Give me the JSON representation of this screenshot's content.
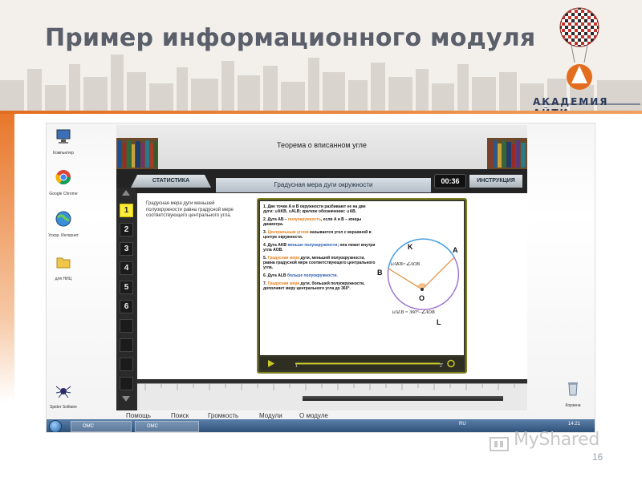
{
  "slide": {
    "title": "Пример информационного модуля",
    "page_number": "16",
    "logo_text": "АКАДЕМИЯ АЙТИ",
    "watermark": "MyShared"
  },
  "desktop": {
    "icons": [
      {
        "name": "computer",
        "label": "Компьютер"
      },
      {
        "name": "chrome",
        "label": "Google Chrome"
      },
      {
        "name": "globe",
        "label": "Ускор. Интернет"
      },
      {
        "name": "folder",
        "label": "для НИЦ"
      },
      {
        "name": "spider",
        "label": "Spider Solitaire"
      },
      {
        "name": "recycle-bin",
        "label": "Корзина"
      }
    ]
  },
  "app": {
    "window_title": "Теорема о вписанном угле",
    "tab_statistics": "СТАТИСТИКА",
    "tab_instructions": "ИНСТРУКЦИЯ",
    "timer": "00:36",
    "section_title": "Градусная мера дуги окружности",
    "description": "Градусная мера дуги меньшей полуокружности равна градусной мере соответствующего центрального угла.",
    "nav_items": [
      "1",
      "2",
      "3",
      "4",
      "5",
      "6"
    ],
    "lesson": {
      "p1": "1. Две точки A и B окружности разбивают ее на две дуги: ∪AKB, ∪ALB; краткое обозначение: ∪AB.",
      "p2a": "2. Дуга AB – ",
      "p2b": "полуокружность",
      "p2c": ", если A и B – концы диаметра.",
      "p3a": "3. ",
      "p3b": "Центральным углом",
      "p3c": " называется угол с вершиной в центре окружности.",
      "p4a": "4. Дуга AKB ",
      "p4b": "меньше полуокружности",
      "p4c": "; она лежит внутри угла AOB.",
      "p5a": "5. ",
      "p5b": "Градусная мера",
      "p5c": " дуги, меньшей полуокружности, равна градусной мере соответствующего центрального угла.",
      "p6a": "6. Дуга ALB ",
      "p6b": "больше полуокружности",
      "p6c": ".",
      "p7a": "7. ",
      "p7b": "Градусная мера",
      "p7c": " дуги, большей полуокружности, дополняет меру центрального угла до 360°."
    },
    "diagram": {
      "label_k": "K",
      "label_a": "A",
      "label_b": "B",
      "label_o": "O",
      "label_l": "L",
      "formula1": "∪AKB=∠AOB",
      "formula2": "∪ALB = 360°–∠AOB"
    },
    "player": {
      "start": "1",
      "end": "2"
    },
    "menu": [
      "Помощь",
      "Поиск",
      "Громкость",
      "Модули",
      "О модуле"
    ]
  },
  "taskbar": {
    "items": [
      "OMC",
      "OMC"
    ],
    "lang": "RU",
    "time": "14:21"
  },
  "colors": {
    "accent": "#e36d1f",
    "highlight": "#fbeb3a",
    "arc_blue": "#4aa3df",
    "arc_purple": "#9a6ed0"
  }
}
